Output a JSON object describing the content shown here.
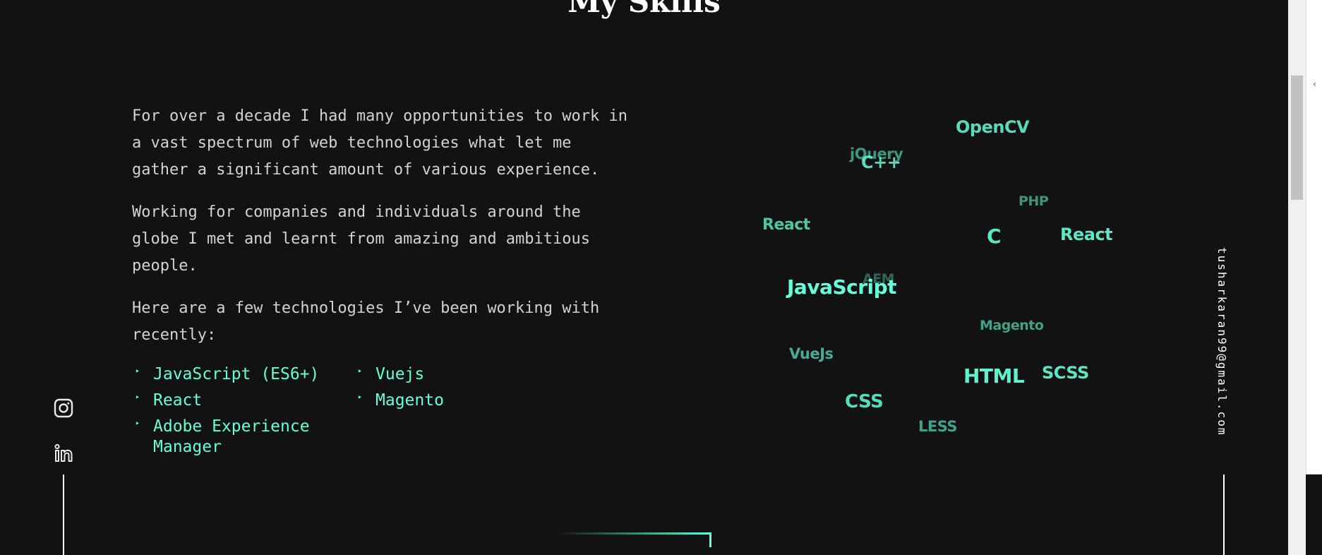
{
  "section": {
    "title": "My Skills"
  },
  "about": {
    "paragraphs": [
      "For over a decade I had many opportunities to work in a vast spectrum of web technologies what let me gather a significant amount of various experience.",
      "Working for companies and individuals around the globe I met and learnt from amazing and ambitious people.",
      "Here are a few technologies I’ve been working with recently:"
    ]
  },
  "skills": {
    "bullet": "‣",
    "items": [
      "JavaScript (ES6+)",
      "Vuejs",
      "React",
      "Magento",
      "Adobe Experience Manager"
    ]
  },
  "cloud": {
    "words": [
      {
        "text": "OpenCV",
        "opacity": 0.85
      },
      {
        "text": "jQuery",
        "opacity": 0.55
      },
      {
        "text": "C++",
        "opacity": 0.85
      },
      {
        "text": "PHP",
        "opacity": 0.55
      },
      {
        "text": "React",
        "opacity": 0.75
      },
      {
        "text": "C",
        "opacity": 0.9
      },
      {
        "text": "React",
        "opacity": 0.9
      },
      {
        "text": "AEM",
        "opacity": 0.35
      },
      {
        "text": "JavaScript",
        "opacity": 1
      },
      {
        "text": "Magento",
        "opacity": 0.6
      },
      {
        "text": "VueJs",
        "opacity": 0.65
      },
      {
        "text": "HTML",
        "opacity": 0.95
      },
      {
        "text": "SCSS",
        "opacity": 0.9
      },
      {
        "text": "CSS",
        "opacity": 0.85
      },
      {
        "text": "LESS",
        "opacity": 0.6
      }
    ]
  },
  "social": {
    "icons": [
      "instagram-icon",
      "linkedin-icon"
    ]
  },
  "contact": {
    "email": "tusharkaran99@gmail.com"
  },
  "colors": {
    "background": "#121212",
    "accent": "#64ffda",
    "text": "#d2d2d2",
    "heading": "#ffffff"
  }
}
